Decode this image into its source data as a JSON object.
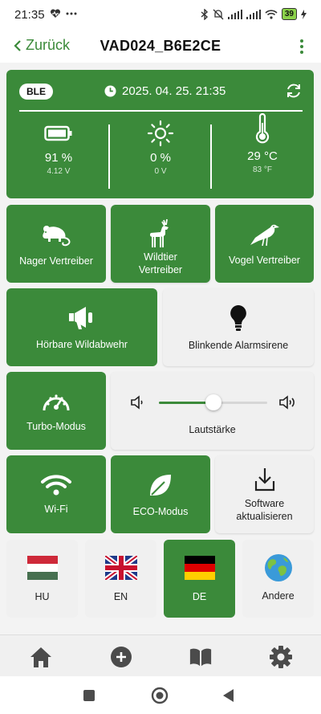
{
  "status_bar": {
    "time": "21:35",
    "battery_level": "39"
  },
  "app_bar": {
    "back_label": "Zurück",
    "title": "VAD024_B6E2CE"
  },
  "status_card": {
    "connection": "BLE",
    "datetime": "2025. 04. 25. 21:35",
    "battery": {
      "percent": "91 %",
      "voltage": "4.12 V"
    },
    "solar": {
      "percent": "0 %",
      "voltage": "0 V"
    },
    "temperature": {
      "celsius": "29 °C",
      "fahrenheit": "83 °F"
    }
  },
  "modes": {
    "rodent": "Nager Vertreiber",
    "wildlife": "Wildtier\nVertreiber",
    "bird": "Vogel Vertreiber",
    "audible_deterrent": "Hörbare Wildabwehr",
    "flashing_siren": "Blinkende Alarmsirene",
    "turbo": "Turbo-Modus",
    "wifi": "Wi-Fi",
    "eco": "ECO-Modus",
    "software_update": "Software\naktualisieren"
  },
  "volume": {
    "label": "Lautstärke",
    "level_fraction": 0.5
  },
  "languages": [
    {
      "code": "HU",
      "selected": false
    },
    {
      "code": "EN",
      "selected": false
    },
    {
      "code": "DE",
      "selected": true
    },
    {
      "code": "Andere",
      "selected": false
    }
  ],
  "colors": {
    "accent": "#3b8a3a",
    "tile_off": "#f0f0f0"
  },
  "icons": {
    "nav": [
      "home-icon",
      "add-circle-icon",
      "book-icon",
      "settings-gear-icon"
    ],
    "system": [
      "recents-square-icon",
      "home-circle-icon",
      "back-triangle-icon"
    ]
  }
}
